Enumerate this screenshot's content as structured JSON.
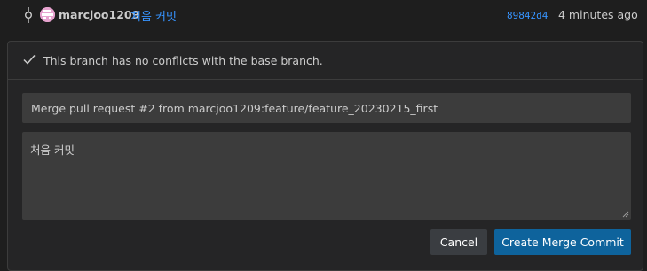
{
  "commit": {
    "author": "marcjoo1209",
    "message": "처음 커밋",
    "sha": "89842d4",
    "time": "4 minutes ago"
  },
  "merge_status": {
    "text": "This branch has no conflicts with the base branch.",
    "icon": "check-icon"
  },
  "form": {
    "title_value": "Merge pull request #2 from marcjoo1209:feature/feature_20230215_first",
    "body_value": "처음 커밋"
  },
  "actions": {
    "cancel_label": "Cancel",
    "merge_label": "Create Merge Commit"
  },
  "colors": {
    "link": "#3794ff",
    "primary_button": "#0e639c",
    "secondary_button": "#3a3d41",
    "input_background": "#3c3c3c",
    "panel_background": "#252526",
    "page_background": "#1e1e1e"
  }
}
